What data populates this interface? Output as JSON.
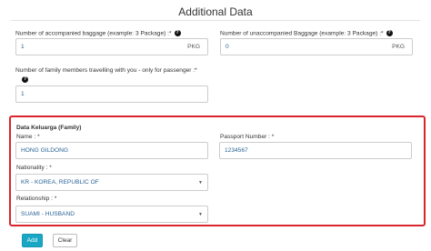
{
  "page": {
    "title": "Additional Data"
  },
  "baggage": {
    "accompanied": {
      "label": "Number of accompanied baggage (example: 3 Package) :*",
      "value": "1",
      "unit": "PKG"
    },
    "unaccompanied": {
      "label": "Number of unaccompanied Baggage (example: 3 Package) :*",
      "value": "0",
      "unit": "PKG"
    }
  },
  "family_count": {
    "label": "Number of family members travelling with you - only for passenger :*",
    "value": "1"
  },
  "family": {
    "heading": "Data Keluarga (Family)",
    "name": {
      "label": "Name : *",
      "value": "HONG GILDONG"
    },
    "passport": {
      "label": "Passport Number : *",
      "value": "1234567"
    },
    "nationality": {
      "label": "Nationality : *",
      "value": "KR - KOREA, REPUBLIC OF"
    },
    "relationship": {
      "label": "Relationship : *",
      "value": "SUAMI - HUSBAND"
    }
  },
  "actions": {
    "add_label": "Add",
    "clear_label": "Clear"
  },
  "icons": {
    "help": "question-circle-icon",
    "dropdown": "caret-down-icon"
  },
  "colors": {
    "accent": "#1aa7c4",
    "highlight_border": "#d9262c",
    "value_text": "#2a6496"
  }
}
